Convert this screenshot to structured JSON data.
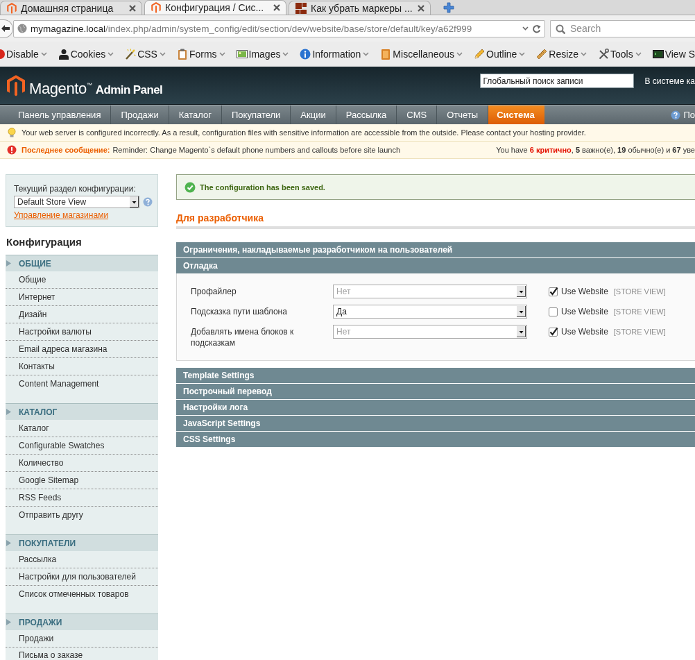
{
  "browser": {
    "tabs": [
      {
        "title": "Домашняя страница",
        "selected": false
      },
      {
        "title": "Конфигурация / Сис...",
        "selected": true
      },
      {
        "title": "Как убрать маркеры ...",
        "selected": false
      }
    ],
    "address": {
      "host": "mymagazine.local",
      "path": "/index.php/admin/system_config/edit/section/dev/website/base/store/default/key/a62f999"
    },
    "search": {
      "placeholder": "Search"
    },
    "toolbar": [
      {
        "label": "Disable",
        "dropdown": true
      },
      {
        "label": "Cookies",
        "dropdown": true
      },
      {
        "label": "CSS",
        "dropdown": true
      },
      {
        "label": "Forms",
        "dropdown": true
      },
      {
        "label": "Images",
        "dropdown": true
      },
      {
        "label": "Information",
        "dropdown": true
      },
      {
        "label": "Miscellaneous",
        "dropdown": true
      },
      {
        "label": "Outline",
        "dropdown": true
      },
      {
        "label": "Resize",
        "dropdown": true
      },
      {
        "label": "Tools",
        "dropdown": true
      },
      {
        "label": "View S",
        "dropdown": false
      }
    ]
  },
  "header": {
    "logo": "Magento$^{™}$",
    "subtitle": "Admin Panel",
    "search": {
      "value": "Глобальный поиск записи"
    },
    "user_text": "В системе ка"
  },
  "menu": {
    "items": [
      {
        "label": "Панель управления",
        "selected": false
      },
      {
        "label": "Продажи",
        "selected": false
      },
      {
        "label": "Каталог",
        "selected": false
      },
      {
        "label": "Покупатели",
        "selected": false
      },
      {
        "label": "Акции",
        "selected": false
      },
      {
        "label": "Рассылка",
        "selected": false
      },
      {
        "label": "CMS",
        "selected": false
      },
      {
        "label": "Отчеты",
        "selected": false
      },
      {
        "label": "Система",
        "selected": true
      }
    ],
    "help": "По"
  },
  "notices": [
    {
      "kind": "warning",
      "text": "Your web server is configured incorrectly. As a result, configuration files with sensitive information are accessible from the outside. Please contact your hosting provider."
    },
    {
      "kind": "error",
      "title": "Последнее сообщение:",
      "text": "Reminder: Change Magento`s default phone numbers and callouts before site launch",
      "summary": "You have **6 критично**, **5** важно(е), **19** обычно(е) и **67** уве"
    }
  ],
  "store_switcher": {
    "label": "Текущий раздел конфигурации:",
    "value": "Default Store View",
    "link": "Управление магазинами"
  },
  "sidebar": {
    "title": "Конфигурация",
    "sections": [
      {
        "title": "ОБЩИЕ",
        "items": [
          {
            "label": "Общие",
            "selected": false
          },
          {
            "label": "Интернет",
            "selected": false
          },
          {
            "label": "Дизайн",
            "selected": false
          },
          {
            "label": "Настройки валюты",
            "selected": false
          },
          {
            "label": "Email адреса магазина",
            "selected": false
          },
          {
            "label": "Контакты",
            "selected": false
          },
          {
            "label": "Content Management",
            "selected": false
          }
        ]
      },
      {
        "title": "КАТАЛОГ",
        "items": [
          {
            "label": "Каталог",
            "selected": false
          },
          {
            "label": "Configurable Swatches",
            "selected": false
          },
          {
            "label": "Количество",
            "selected": false
          },
          {
            "label": "Google Sitemap",
            "selected": false
          },
          {
            "label": "RSS Feeds",
            "selected": false
          },
          {
            "label": "Отправить другу",
            "selected": false
          }
        ]
      },
      {
        "title": "ПОКУПАТЕЛИ",
        "items": [
          {
            "label": "Рассылка",
            "selected": false
          },
          {
            "label": "Настройки для пользователей",
            "selected": false
          },
          {
            "label": "Список отмеченных товаров",
            "selected": false
          }
        ]
      },
      {
        "title": "ПРОДАЖИ",
        "items": [
          {
            "label": "Продажи",
            "selected": false
          },
          {
            "label": "Письма о заказе",
            "selected": false
          }
        ]
      }
    ]
  },
  "messages": [
    {
      "kind": "success",
      "text": "The configuration has been saved."
    }
  ],
  "page_title": "Для разработчика",
  "groups": [
    {
      "title": "Ограничения, накладываемые разработчиком на пользователей"
    },
    {
      "title": "Отладка",
      "fields": [
        {
          "label": "Профайлер",
          "value": "Нет",
          "disabled": true,
          "inherit": {
            "label": "Use Website",
            "checked": true
          },
          "scope": "[STORE VIEW]"
        },
        {
          "label": "Подсказка пути шаблона",
          "value": "Да",
          "disabled": false,
          "inherit": {
            "label": "Use Website",
            "checked": false
          },
          "scope": "[STORE VIEW]"
        },
        {
          "label": "Добавлять имена блоков к подсказкам",
          "value": "Нет",
          "disabled": true,
          "inherit": {
            "label": "Use Website",
            "checked": true
          },
          "scope": "[STORE VIEW]"
        }
      ]
    },
    {
      "title": "Template Settings"
    },
    {
      "title": "Построчный перевод"
    },
    {
      "title": "Настройки лога"
    },
    {
      "title": "JavaScript Settings"
    },
    {
      "title": "CSS Settings"
    }
  ]
}
